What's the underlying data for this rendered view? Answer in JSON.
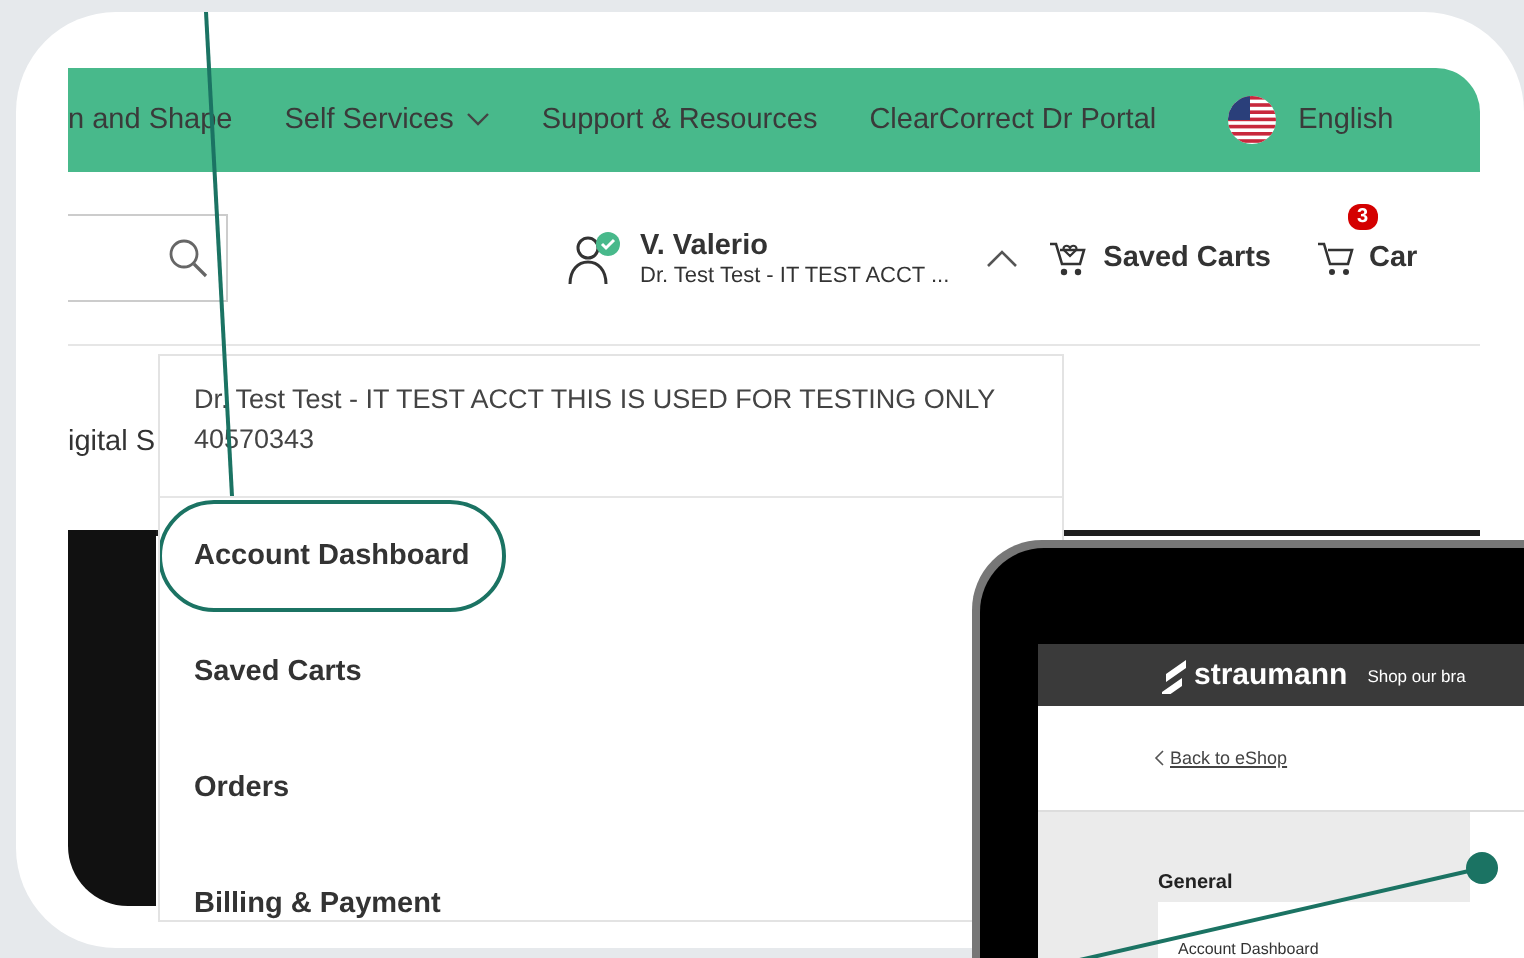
{
  "nav": {
    "items": [
      {
        "label": "n and Shape",
        "dropdown": false
      },
      {
        "label": "Self Services",
        "dropdown": true
      },
      {
        "label": "Support & Resources",
        "dropdown": false
      },
      {
        "label": "ClearCorrect Dr Portal",
        "dropdown": false
      }
    ],
    "language": "English"
  },
  "header": {
    "user": {
      "name": "V. Valerio",
      "account": "Dr. Test Test - IT TEST ACCT ...",
      "verified": true,
      "expanded": true
    },
    "saved_carts": "Saved Carts",
    "cart": {
      "label": "Car",
      "count": "3"
    }
  },
  "subnav_text": "igital S",
  "account_menu": {
    "account_line": "Dr. Test Test - IT TEST ACCT THIS IS USED FOR TESTING ONLY",
    "account_number": "40570343",
    "items": [
      {
        "label": "Account Dashboard",
        "highlighted": true
      },
      {
        "label": "Saved Carts",
        "highlighted": false
      },
      {
        "label": "Orders",
        "highlighted": false
      },
      {
        "label": "Billing & Payment",
        "highlighted": false
      }
    ]
  },
  "tablet": {
    "brand": "straumann",
    "nav_text": "Shop our bra",
    "back_link": "Back to eShop",
    "section": "General",
    "item": "Account Dashboard"
  }
}
